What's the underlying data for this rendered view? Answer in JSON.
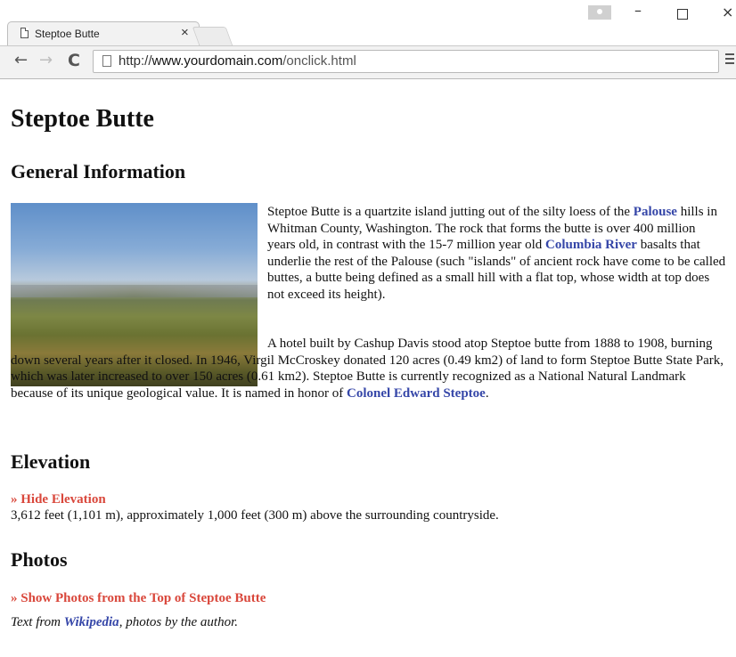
{
  "browser": {
    "tab_title": "Steptoe Butte",
    "tab_close": "×",
    "url_scheme": "http://",
    "url_host": "www.yourdomain.com",
    "url_path": "/onclick.html",
    "window_min": "–",
    "window_close": "×",
    "nav_back": "←",
    "nav_forward": "→",
    "nav_reload": "C"
  },
  "page": {
    "title": "Steptoe Butte",
    "general": {
      "heading": "General Information",
      "photo_icon": "butte-landscape-photo",
      "p1_text_a": "Steptoe Butte is a quartzite island jutting out of the silty loess of the ",
      "p1_link_palouse": "Palouse",
      "p1_text_b": " hills in Whitman County, Washington. The rock that forms the butte is over 400 million years old, in contrast with the 15-7 million year old ",
      "p1_link_columbia": "Columbia River",
      "p1_text_c": " basalts that underlie the rest of the Palouse (such \"islands\" of ancient rock have come to be called buttes, a butte being defined as a small hill with a flat top, whose width at top does not exceed its height).",
      "p2_text_a": "A hotel built by Cashup Davis stood atop Steptoe butte from 1888 to 1908, burning down several years after it closed. In 1946, Virgil McCroskey donated 120 acres (0.49 km2) of land to form Steptoe Butte State Park, which was later increased to over 150 acres (0.61 km2). Steptoe Butte is currently recognized as a National Natural Landmark because of its unique geological value. It is named in honor of ",
      "p2_link_steptoe": "Colonel Edward Steptoe",
      "p2_text_b": "."
    },
    "elevation": {
      "heading": "Elevation",
      "toggle": "» Hide Elevation",
      "text": "3,612 feet (1,101 m), approximately 1,000 feet (300 m) above the surrounding countryside."
    },
    "photos": {
      "heading": "Photos",
      "toggle": "» Show Photos from the Top of Steptoe Butte",
      "credit_a": "Text from ",
      "credit_link": "Wikipedia",
      "credit_b": ", photos by the author."
    }
  },
  "colors": {
    "link": "#3546a8",
    "toggle": "#d9473b"
  }
}
